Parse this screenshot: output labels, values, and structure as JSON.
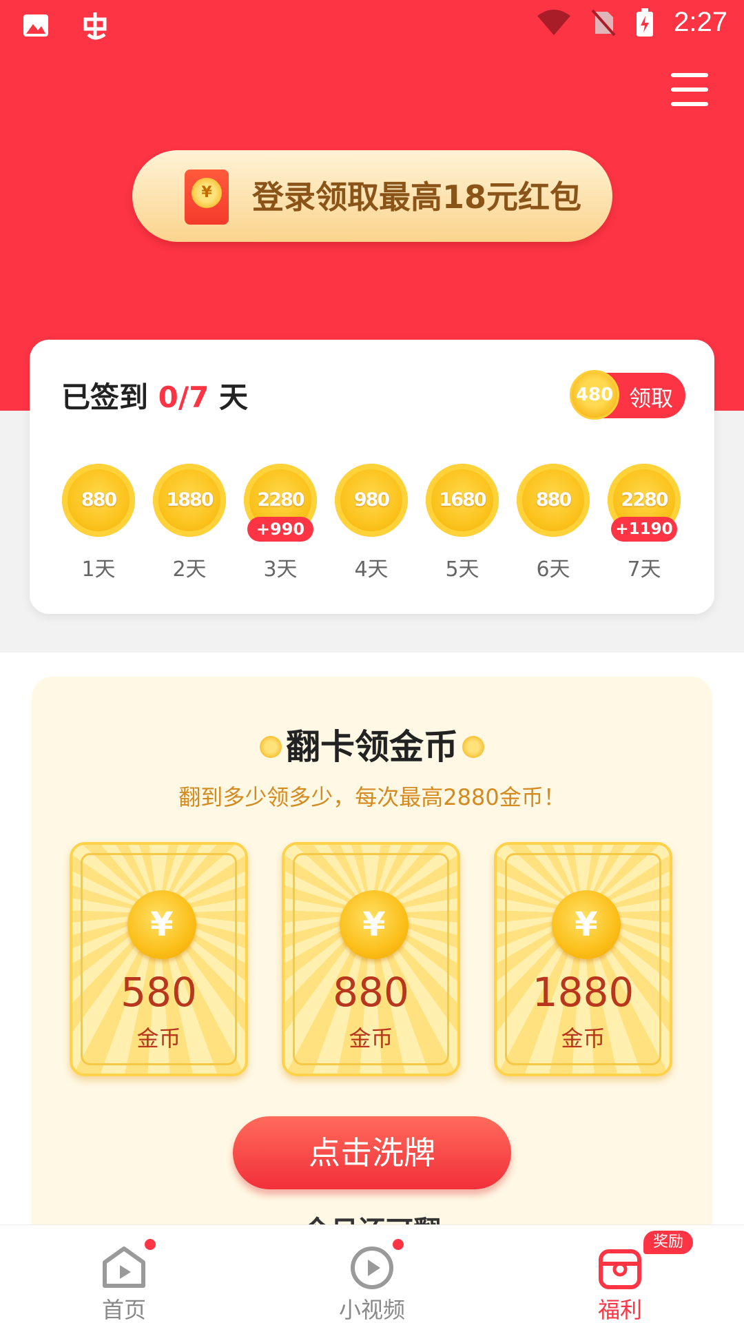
{
  "status_bar": {
    "time": "2:27"
  },
  "banner": {
    "login_text": "登录领取最高18元红包",
    "coin_symbol": "¥"
  },
  "sign_in": {
    "title_prefix": "已签到 ",
    "progress": "0/7",
    "title_suffix": " 天",
    "claim_coin": "480",
    "claim_label": "领取",
    "days": [
      {
        "coins": "880",
        "label": "1天",
        "bonus": ""
      },
      {
        "coins": "1880",
        "label": "2天",
        "bonus": ""
      },
      {
        "coins": "2280",
        "label": "3天",
        "bonus": "+990"
      },
      {
        "coins": "980",
        "label": "4天",
        "bonus": ""
      },
      {
        "coins": "1680",
        "label": "5天",
        "bonus": ""
      },
      {
        "coins": "880",
        "label": "6天",
        "bonus": ""
      },
      {
        "coins": "2280",
        "label": "7天",
        "bonus": "+1190"
      }
    ]
  },
  "flip": {
    "title": "翻卡领金币",
    "subtitle": "翻到多少领多少，每次最高2880金币！",
    "cards": [
      {
        "value": "580",
        "unit": "金币",
        "symbol": "¥"
      },
      {
        "value": "880",
        "unit": "金币",
        "symbol": "¥"
      },
      {
        "value": "1880",
        "unit": "金币",
        "symbol": "¥"
      }
    ],
    "shuffle_label": "点击洗牌",
    "cut_text": "今日还可翻"
  },
  "nav": {
    "items": [
      {
        "label": "首页",
        "icon": "home-play-icon"
      },
      {
        "label": "小视频",
        "icon": "video-play-icon"
      },
      {
        "label": "福利",
        "icon": "gift-icon",
        "badge": "奖励"
      }
    ]
  },
  "colors": {
    "primary_red": "#fc3444",
    "gold": "#fbc21c",
    "panel_cream": "#fff8e4"
  }
}
